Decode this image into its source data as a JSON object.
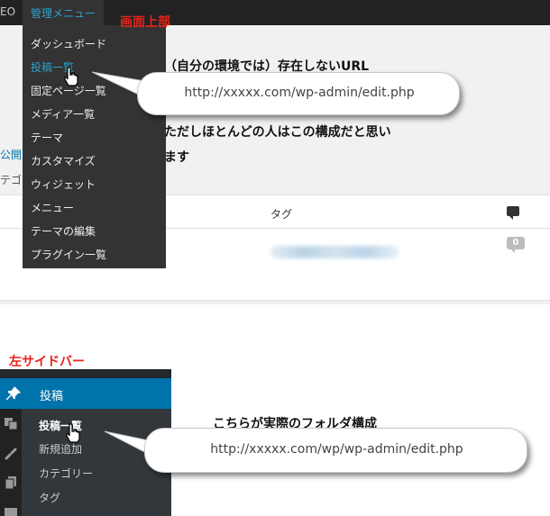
{
  "top_panel": {
    "adminbar": {
      "left_text": "EO",
      "menu_label": "管理メニュー"
    },
    "dropdown": {
      "items": [
        {
          "label": "ダッシュボード"
        },
        {
          "label": "投稿一覧"
        },
        {
          "label": "固定ページ一覧"
        },
        {
          "label": "メディア一覧"
        },
        {
          "label": "テーマ"
        },
        {
          "label": "カスタマイズ"
        },
        {
          "label": "ウィジェット"
        },
        {
          "label": "メニュー"
        },
        {
          "label": "テーマの編集"
        },
        {
          "label": "プラグイン一覧"
        }
      ]
    },
    "background": {
      "publish_link": "公開 (",
      "category_text": "テゴリ",
      "tags_header": "タグ",
      "comment_count": "0"
    },
    "callout": {
      "header_label": "画面上部",
      "note_top": "（自分の環境では）存在しないURL",
      "url": "http://xxxxx.com/wp-admin/edit.php",
      "note_line1": "ただしほとんどの人はこの構成だと思い",
      "note_line2": "ます"
    }
  },
  "sidebar_panel": {
    "label": "左サイドバー",
    "menu": {
      "posts_label": "投稿",
      "submenu": [
        {
          "label": "投稿一覧"
        },
        {
          "label": "新規追加"
        },
        {
          "label": "カテゴリー"
        },
        {
          "label": "タグ"
        }
      ]
    },
    "callout": {
      "note": "こちらが実際のフォルダ構成",
      "url": "http://xxxxx.com/wp/wp-admin/edit.php"
    }
  },
  "colors": {
    "annotation_red": "#e8231a",
    "wp_blue": "#0073aa",
    "link_blue": "#2ea2cc",
    "admin_dark": "#333333"
  },
  "icons": [
    "pin-icon",
    "media-icon",
    "link-icon",
    "pages-icon",
    "comments-icon",
    "pointer-cursor-icon",
    "comment-bubble-icon"
  ]
}
